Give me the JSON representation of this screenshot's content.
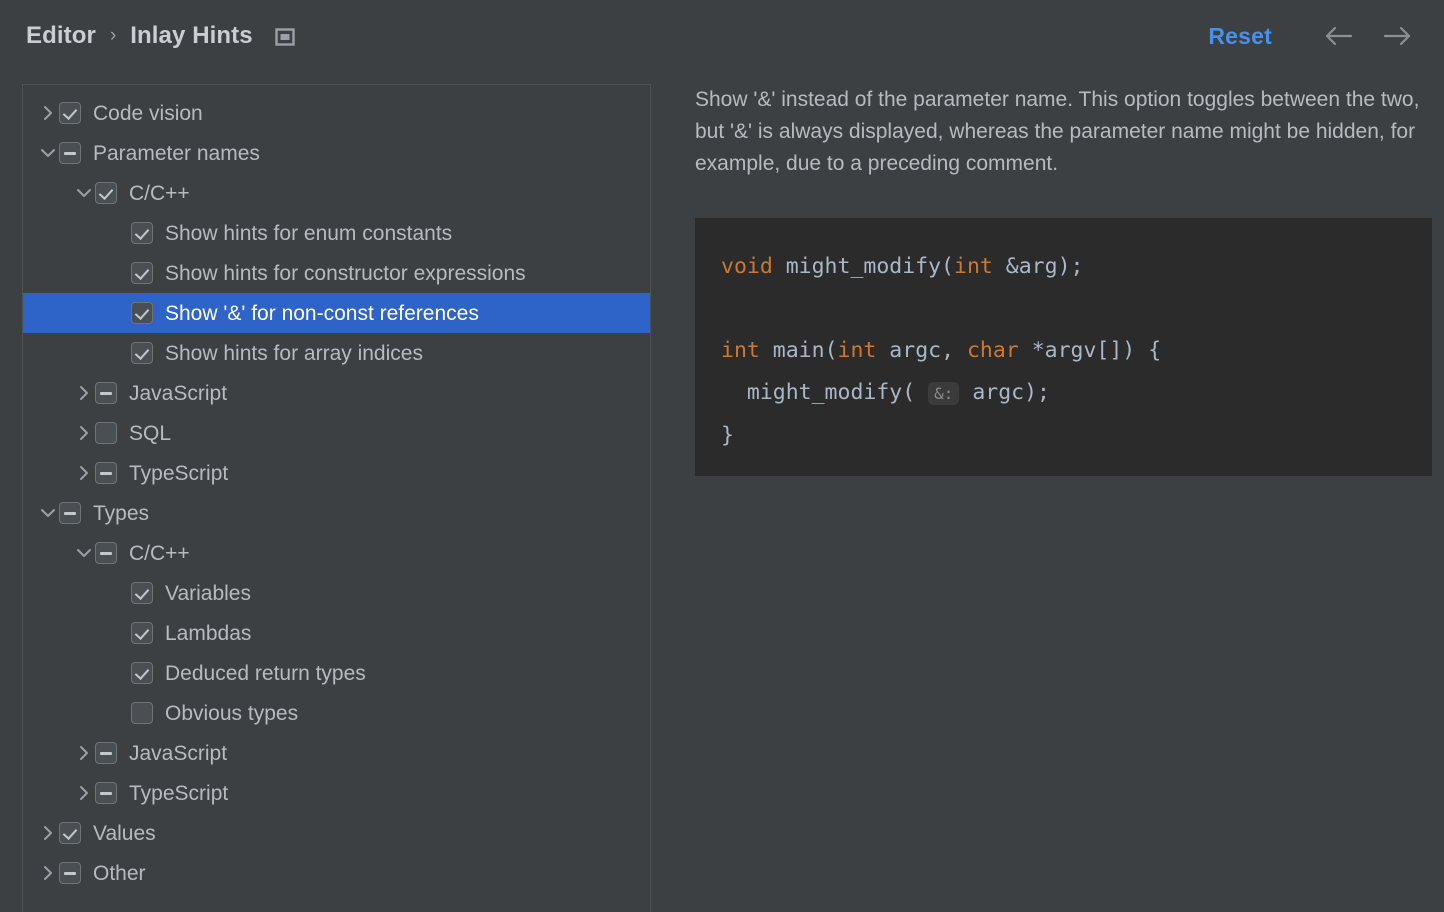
{
  "header": {
    "breadcrumb": [
      {
        "label": "Editor"
      },
      {
        "label": "Inlay Hints"
      }
    ],
    "separator": "›",
    "settings_icon": "window-settings-icon",
    "reset_label": "Reset",
    "back_icon": "arrow-left-icon",
    "forward_icon": "arrow-right-icon",
    "accent_color": "#4a90e8"
  },
  "tree": {
    "selection_color": "#2e63c8",
    "rows": [
      {
        "level": 0,
        "twisty": "collapsed",
        "check": "checked",
        "label": "Code vision"
      },
      {
        "level": 0,
        "twisty": "expanded",
        "check": "partial",
        "label": "Parameter names"
      },
      {
        "level": 1,
        "twisty": "expanded",
        "check": "checked",
        "label": "C/C++"
      },
      {
        "level": 2,
        "twisty": "none",
        "check": "checked",
        "label": "Show hints for enum constants"
      },
      {
        "level": 2,
        "twisty": "none",
        "check": "checked",
        "label": "Show hints for constructor expressions"
      },
      {
        "level": 2,
        "twisty": "none",
        "check": "checked",
        "label": "Show '&' for non-const references",
        "selected": true
      },
      {
        "level": 2,
        "twisty": "none",
        "check": "checked",
        "label": "Show hints for array indices"
      },
      {
        "level": 1,
        "twisty": "collapsed",
        "check": "partial",
        "label": "JavaScript"
      },
      {
        "level": 1,
        "twisty": "collapsed",
        "check": "unchecked",
        "label": "SQL"
      },
      {
        "level": 1,
        "twisty": "collapsed",
        "check": "partial",
        "label": "TypeScript"
      },
      {
        "level": 0,
        "twisty": "expanded",
        "check": "partial",
        "label": "Types"
      },
      {
        "level": 1,
        "twisty": "expanded",
        "check": "partial",
        "label": "C/C++"
      },
      {
        "level": 2,
        "twisty": "none",
        "check": "checked",
        "label": "Variables"
      },
      {
        "level": 2,
        "twisty": "none",
        "check": "checked",
        "label": "Lambdas"
      },
      {
        "level": 2,
        "twisty": "none",
        "check": "checked",
        "label": "Deduced return types"
      },
      {
        "level": 2,
        "twisty": "none",
        "check": "unchecked",
        "label": "Obvious types"
      },
      {
        "level": 1,
        "twisty": "collapsed",
        "check": "partial",
        "label": "JavaScript"
      },
      {
        "level": 1,
        "twisty": "collapsed",
        "check": "partial",
        "label": "TypeScript"
      },
      {
        "level": 0,
        "twisty": "collapsed",
        "check": "checked",
        "label": "Values"
      },
      {
        "level": 0,
        "twisty": "collapsed",
        "check": "partial",
        "label": "Other"
      }
    ]
  },
  "detail": {
    "description": "Show '&' instead of the parameter name. This option toggles between the two, but '&' is always displayed, whereas the parameter name might be hidden, for example, due to a preceding comment.",
    "code": {
      "background": "#2b2b2b",
      "keyword_color": "#cc7832",
      "text_color": "#a9b7c6",
      "hint_chip": "&:",
      "lines": [
        [
          {
            "t": "void",
            "c": "kw"
          },
          {
            "t": " might_modify(",
            "c": "pl"
          },
          {
            "t": "int",
            "c": "kw"
          },
          {
            "t": " &arg);",
            "c": "pl"
          }
        ],
        [
          {
            "t": "",
            "c": "pl"
          }
        ],
        [
          {
            "t": "int",
            "c": "kw"
          },
          {
            "t": " main(",
            "c": "pl"
          },
          {
            "t": "int",
            "c": "kw"
          },
          {
            "t": " argc, ",
            "c": "pl"
          },
          {
            "t": "char",
            "c": "kw"
          },
          {
            "t": " *argv[]) {",
            "c": "pl"
          }
        ],
        [
          {
            "t": "  might_modify( ",
            "c": "pl"
          },
          {
            "t": "&:",
            "c": "hint"
          },
          {
            "t": " argc);",
            "c": "pl"
          }
        ],
        [
          {
            "t": "}",
            "c": "pl"
          }
        ]
      ]
    }
  }
}
